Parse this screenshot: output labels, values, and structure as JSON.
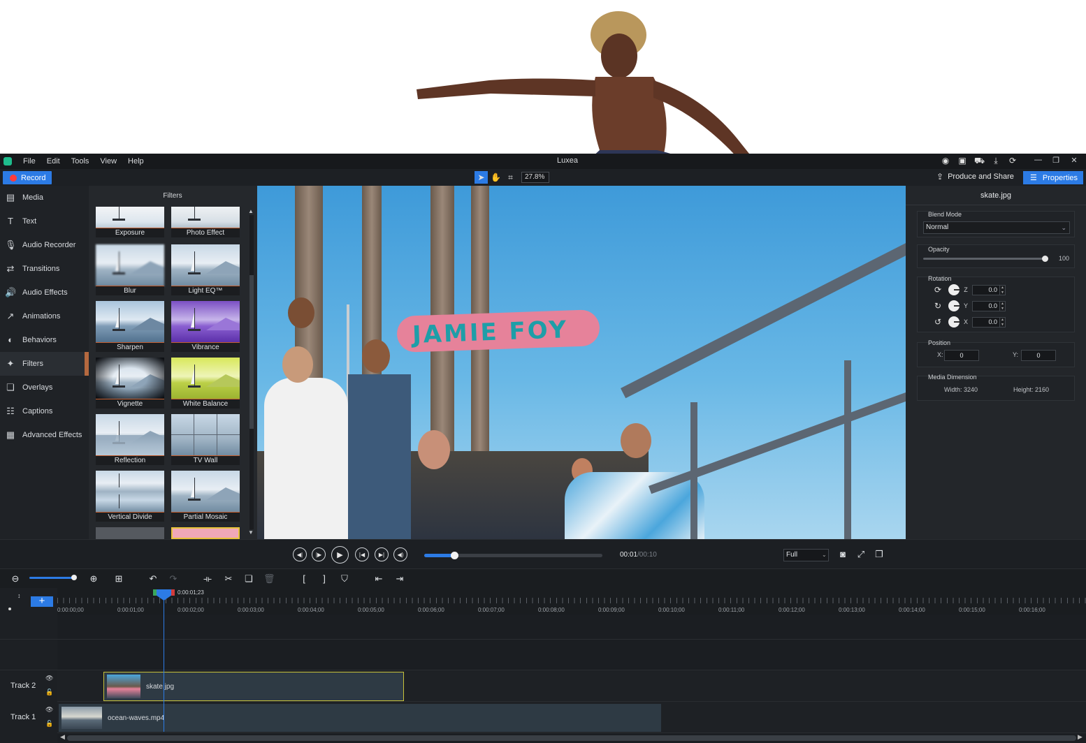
{
  "app": {
    "title": "Luxea",
    "menu": [
      "File",
      "Edit",
      "Tools",
      "View",
      "Help"
    ]
  },
  "toolbar": {
    "record_label": "Record",
    "zoom_value": "27.8%",
    "produce_label": "Produce and Share",
    "properties_label": "Properties"
  },
  "sidebar": {
    "items": [
      {
        "label": "Media",
        "icon": "media-icon"
      },
      {
        "label": "Text",
        "icon": "text-icon"
      },
      {
        "label": "Audio Recorder",
        "icon": "microphone-icon"
      },
      {
        "label": "Transitions",
        "icon": "transitions-icon"
      },
      {
        "label": "Audio Effects",
        "icon": "speaker-icon"
      },
      {
        "label": "Animations",
        "icon": "animation-arrow-icon"
      },
      {
        "label": "Behaviors",
        "icon": "behaviors-icon"
      },
      {
        "label": "Filters",
        "icon": "magic-wand-icon"
      },
      {
        "label": "Overlays",
        "icon": "overlays-icon"
      },
      {
        "label": "Captions",
        "icon": "captions-icon"
      },
      {
        "label": "Advanced Effects",
        "icon": "advanced-effects-icon"
      }
    ],
    "active": "Filters"
  },
  "filters": {
    "title": "Filters",
    "items": [
      "Exposure",
      "Photo Effect",
      "Blur",
      "Light EQ™",
      "Sharpen",
      "Vibrance",
      "Vignette",
      "White Balance",
      "Reflection",
      "TV Wall",
      "Vertical Divide",
      "Partial Mosaic"
    ]
  },
  "properties": {
    "file_name": "skate.jpg",
    "blend_mode_label": "Blend Mode",
    "blend_mode_value": "Normal",
    "opacity_label": "Opacity",
    "opacity_value": "100",
    "rotation_label": "Rotation",
    "rotation": [
      {
        "axis": "Z",
        "value": "0.0"
      },
      {
        "axis": "Y",
        "value": "0.0"
      },
      {
        "axis": "X",
        "value": "0.0"
      }
    ],
    "position_label": "Position",
    "position_x_label": "X:",
    "position_x": "0",
    "position_y_label": "Y:",
    "position_y": "0",
    "media_dimension_label": "Media Dimension",
    "width_text": "Width: 3240",
    "height_text": "Height: 2160"
  },
  "playback": {
    "current_time": "00:01",
    "total_time": "/00:10",
    "progress": 0.17,
    "quality": "Full"
  },
  "timeline": {
    "playhead_time": "0:00:01;23",
    "ruler": [
      "0:00:00;00",
      "0:00:01;00",
      "0:00:02;00",
      "0:00:03;00",
      "0:00:04;00",
      "0:00:05;00",
      "0:00:06;00",
      "0:00:07;00",
      "0:00:08;00",
      "0:00:09;00",
      "0:00:10;00",
      "0:00:11;00",
      "0:00:12;00",
      "0:00:13;00",
      "0:00:14;00",
      "0:00:15;00",
      "0:00:16;00"
    ],
    "tracks": [
      {
        "name": "Track 2",
        "clip": "skate.jpg"
      },
      {
        "name": "Track 1",
        "clip": "ocean-waves.mp4"
      }
    ]
  },
  "colors": {
    "accent": "#2c7be5",
    "record": "#ff3b3b",
    "active_marker": "#b5693f",
    "selected_clip_border": "#c8c23a"
  }
}
